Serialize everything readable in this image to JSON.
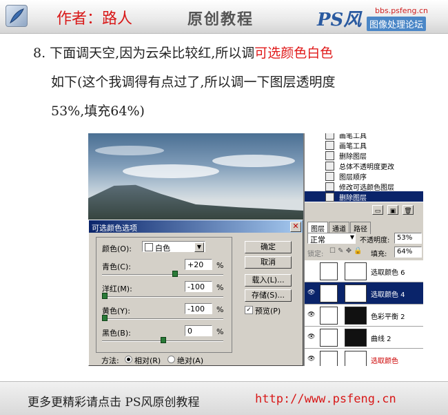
{
  "header": {
    "author": "作者：路人",
    "title": "原创教程",
    "logo_text": "PS风",
    "site": "bbs.psfeng.cn",
    "forum": "图像处理论坛"
  },
  "body": {
    "line1_prefix": "8. 下面调天空,因为云朵比较红,所以调",
    "line1_highlight": "可选颜色白色",
    "line2": "如下(这个我调得有点过了,所以调一下图层透明度",
    "line3": "53%,填充64%)"
  },
  "dialog": {
    "title": "可选颜色选项",
    "color_label": "颜色(O):",
    "color_value": "白色",
    "sliders": [
      {
        "label": "青色(C):",
        "value": "+20",
        "unit": "%",
        "level": 0.6
      },
      {
        "label": "洋红(M):",
        "value": "-100",
        "unit": "%",
        "level": 0.0
      },
      {
        "label": "黄色(Y):",
        "value": "-100",
        "unit": "%",
        "level": 0.0
      },
      {
        "label": "黑色(B):",
        "value": "0",
        "unit": "%",
        "level": 0.5
      }
    ],
    "buttons": {
      "ok": "确定",
      "cancel": "取消",
      "load": "载入(L)...",
      "save": "存储(S)..."
    },
    "preview_label": "预览(P)",
    "method_label": "方法:",
    "relative_label": "相对(R)",
    "absolute_label": "绝对(A)"
  },
  "history": {
    "items": [
      {
        "label": "画笔工具",
        "selected": false
      },
      {
        "label": "画笔工具",
        "selected": false
      },
      {
        "label": "删除图层",
        "selected": false
      },
      {
        "label": "总体不透明度更改",
        "selected": false
      },
      {
        "label": "图层顺序",
        "selected": false
      },
      {
        "label": "修改可选颜色图层",
        "selected": false
      },
      {
        "label": "删除图层",
        "selected": true
      }
    ]
  },
  "layers_panel": {
    "tabs": [
      "图层",
      "通道",
      "路径"
    ],
    "blend_mode": "正常",
    "opacity_label": "不透明度:",
    "opacity_value": "53%",
    "lock_label": "锁定:",
    "fill_label": "填充:",
    "fill_value": "64%",
    "layers": [
      {
        "name": "选取颜色 6",
        "selected": false
      },
      {
        "name": "选取颜色 4",
        "selected": true
      },
      {
        "name": "色彩平衡 2",
        "selected": false
      },
      {
        "name": "曲线 2",
        "selected": false
      },
      {
        "name": "选取颜色",
        "selected": false
      }
    ]
  },
  "footer": {
    "text": "更多更精彩请点击 PS风原创教程",
    "url": "http://www.psfeng.cn"
  }
}
